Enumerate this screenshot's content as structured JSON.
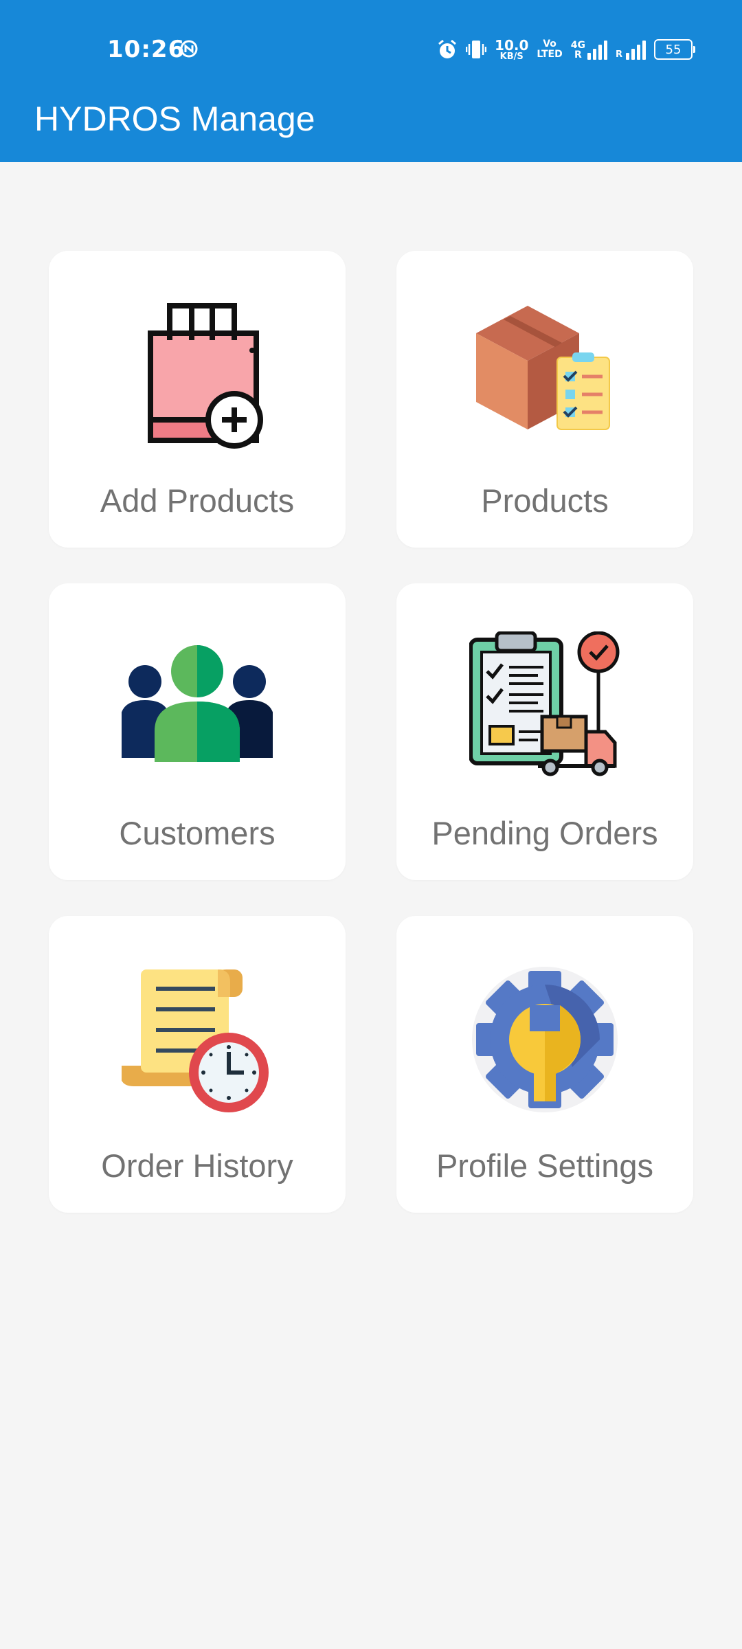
{
  "status_bar": {
    "time": "10:26",
    "net_speed_value": "10.0",
    "net_speed_unit": "KB/S",
    "volte_top": "Vo",
    "volte_bottom": "LTED",
    "network_type": "4G",
    "roaming_1": "R",
    "roaming_2": "R",
    "battery": "55"
  },
  "header": {
    "title": "HYDROS Manage",
    "bg_color": "#1788d8"
  },
  "menu": {
    "items": [
      {
        "label": "Add Products",
        "icon": "add-shopping-bag-icon"
      },
      {
        "label": "Products",
        "icon": "box-checklist-icon"
      },
      {
        "label": "Customers",
        "icon": "people-group-icon"
      },
      {
        "label": "Pending Orders",
        "icon": "clipboard-delivery-icon"
      },
      {
        "label": "Order History",
        "icon": "scroll-clock-icon"
      },
      {
        "label": "Profile Settings",
        "icon": "gear-wrench-icon"
      }
    ]
  }
}
